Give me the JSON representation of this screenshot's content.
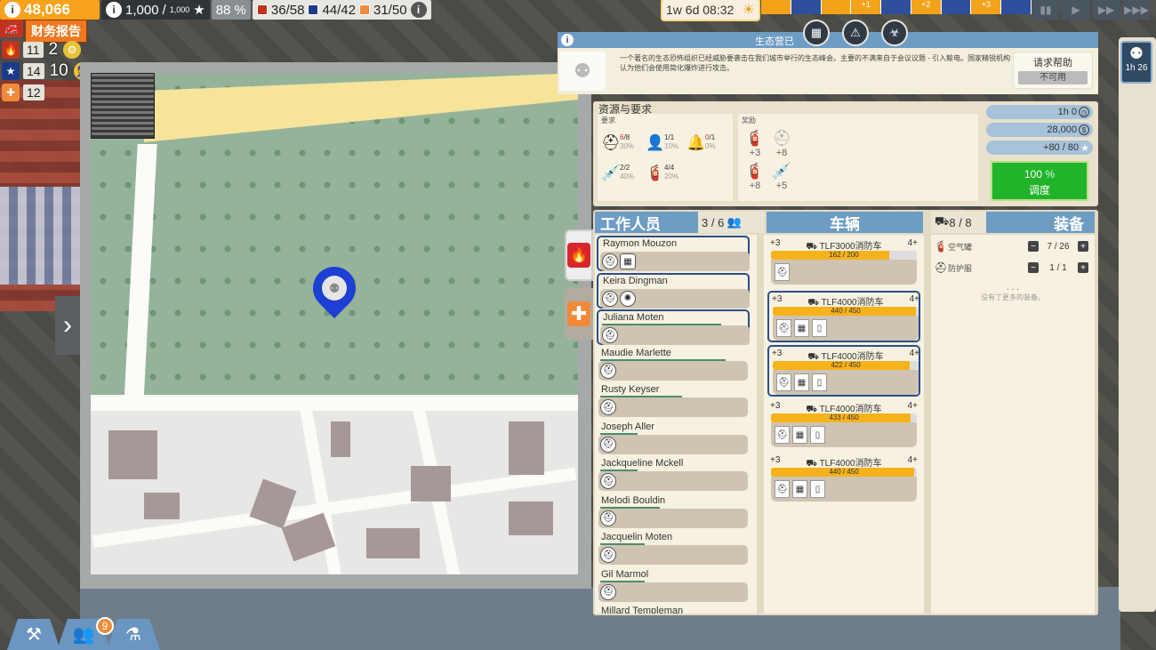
{
  "hud": {
    "money": "48,066",
    "fame": "1,000",
    "fame_max": "1,000",
    "approval": "88 %",
    "fire_counts": "36/58",
    "police_counts": "44/42",
    "medic_counts": "31/50",
    "report_label": "财务报告",
    "side_stats": [
      {
        "value": "11",
        "extra": "2",
        "color": "#c2331f"
      },
      {
        "value": "14",
        "extra": "10",
        "color": "#1d3a8a"
      },
      {
        "value": "12",
        "extra": "",
        "color": "#f08a3a"
      }
    ]
  },
  "time": {
    "label": "1w 6d 08:32",
    "timeline": [
      "",
      "",
      "",
      "+1",
      "",
      "+2",
      "",
      "+3",
      ""
    ]
  },
  "speed_buttons": [
    "▮▮",
    "▶",
    "▶▶",
    "▶▶▶"
  ],
  "mission": {
    "header_info": "i",
    "title": "生态营已",
    "description": "一个著名的生态恐怖组织已经威胁要袭击在我们城市举行的生态峰会。主要的不满来自于会议议题 - 引入鲸电。国家精锐机构认为他们会使用简化爆炸进行攻击。",
    "help": {
      "title": "请求帮助",
      "status": "不可用"
    },
    "tab_icons": [
      "building-icon",
      "alarm-icon",
      "biohazard-icon"
    ]
  },
  "requirements": {
    "title": "资源与要求",
    "req_label": "要求",
    "bonus_label": "奖励",
    "items": [
      {
        "glyph": "⛑",
        "have": "6",
        "need": "8",
        "pct": "30%"
      },
      {
        "glyph": "👤",
        "have": "1",
        "need": "1",
        "pct": "10%"
      },
      {
        "glyph": "🔔",
        "have": "0",
        "need": "1",
        "pct": "0%"
      },
      {
        "glyph": "💉",
        "have": "2",
        "need": "2",
        "pct": "40%"
      },
      {
        "glyph": "🧯",
        "have": "4",
        "need": "4",
        "pct": "20%"
      }
    ],
    "bonuses": [
      {
        "glyph": "🧯",
        "value": "+3"
      },
      {
        "glyph": "⛑",
        "value": "+8"
      },
      {
        "glyph": "🧯",
        "value": "+8"
      },
      {
        "glyph": "💉",
        "value": "+5"
      }
    ]
  },
  "meters": {
    "time": "1h 0",
    "money": "28,000",
    "points": "+80 / 80"
  },
  "dispatch": {
    "percent": "100",
    "unit": "%",
    "label": "调度"
  },
  "staff": {
    "title": "工作人员",
    "count": "3 / 6",
    "members": [
      {
        "name": "Raymon Mouzon",
        "progress": 0.0,
        "selected": true,
        "icons": [
          "⛑",
          "▦"
        ]
      },
      {
        "name": "Keira Dingman",
        "progress": 0.0,
        "selected": true,
        "icons": [
          "⛑",
          "✺"
        ]
      },
      {
        "name": "Juliana Moten",
        "progress": 0.8,
        "selected": true,
        "icons": [
          "⛑"
        ]
      },
      {
        "name": "Maudie Marlette",
        "progress": 0.84,
        "selected": false,
        "icons": [
          "⛑"
        ]
      },
      {
        "name": "Rusty Keyser",
        "progress": 0.55,
        "selected": false,
        "icons": [
          "⛑"
        ]
      },
      {
        "name": "Joseph Aller",
        "progress": 0.25,
        "selected": false,
        "icons": [
          "⛑"
        ]
      },
      {
        "name": "Jackqueline Mckell",
        "progress": 0.25,
        "selected": false,
        "icons": [
          "⛑"
        ]
      },
      {
        "name": "Melodi Bouldin",
        "progress": 0.4,
        "selected": false,
        "icons": [
          "⛑"
        ]
      },
      {
        "name": "Jacquelin Moten",
        "progress": 0.3,
        "selected": false,
        "icons": [
          "⛑"
        ]
      },
      {
        "name": "Gil Marmol",
        "progress": 0.3,
        "selected": false,
        "icons": [
          "⛑"
        ]
      },
      {
        "name": "Millard Templeman",
        "progress": 0.0,
        "selected": false,
        "icons": []
      }
    ]
  },
  "vehicles": {
    "title": "车辆",
    "count": "8 / 8",
    "list": [
      {
        "bonus": "+3",
        "name": "TLF3000消防车",
        "seats": "4+",
        "fuel": "162 / 200",
        "fill": 0.81,
        "selected": false,
        "slots": [
          "⛑"
        ]
      },
      {
        "bonus": "+3",
        "name": "TLF4000消防车",
        "seats": "4+",
        "fuel": "440 / 450",
        "fill": 0.98,
        "selected": true,
        "slots": [
          "⛑",
          "▦",
          "▯"
        ]
      },
      {
        "bonus": "+3",
        "name": "TLF4000消防车",
        "seats": "4+",
        "fuel": "422 / 450",
        "fill": 0.94,
        "selected": true,
        "slots": [
          "⛑",
          "▦",
          "▯"
        ]
      },
      {
        "bonus": "+3",
        "name": "TLF4000消防车",
        "seats": "4+",
        "fuel": "433 / 450",
        "fill": 0.96,
        "selected": false,
        "slots": [
          "⛑",
          "▦",
          "▯"
        ]
      },
      {
        "bonus": "+3",
        "name": "TLF4000消防车",
        "seats": "4+",
        "fuel": "440 / 450",
        "fill": 0.98,
        "selected": false,
        "slots": [
          "⛑",
          "▦",
          "▯"
        ]
      }
    ]
  },
  "equipment": {
    "title": "装备",
    "items": [
      {
        "glyph": "🧯",
        "name": "空气罐",
        "count": "7 / 26"
      },
      {
        "glyph": "⛑",
        "name": "防护服",
        "count": "1 / 1"
      }
    ],
    "more": ". . .",
    "empty_hint": "没有了更多的装备。"
  },
  "side_badge": {
    "time": "1h 26"
  },
  "bottom": {
    "notification": "9"
  }
}
